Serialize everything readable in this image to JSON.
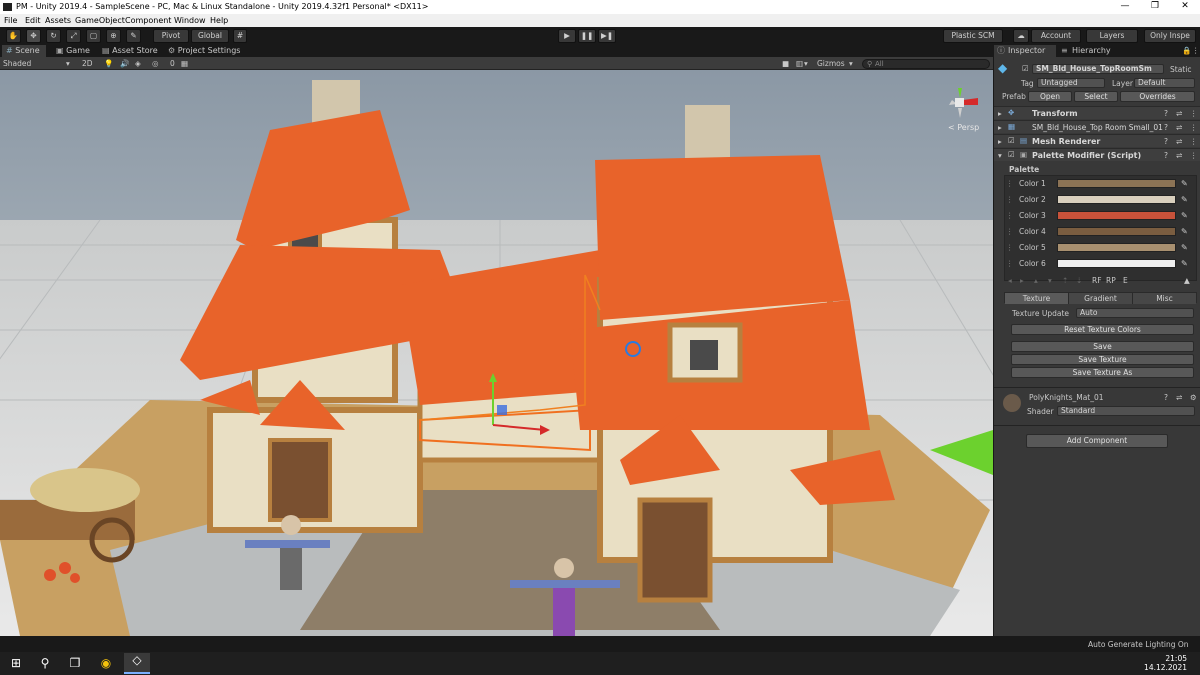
{
  "window": {
    "title": "PM - Unity 2019.4 - SampleScene - PC, Mac & Linux Standalone - Unity 2019.4.32f1 Personal* <DX11>",
    "minimize": "—",
    "maximize": "❐",
    "close": "✕"
  },
  "menu": [
    "File",
    "Edit",
    "Assets",
    "GameObject",
    "Component",
    "Window",
    "Help"
  ],
  "toolbar": {
    "pivot": "Pivot",
    "global": "Global",
    "play": "▶",
    "pause": "❚❚",
    "step": "▶❚",
    "plastic_scm": "Plastic SCM",
    "account": "Account",
    "layers": "Layers",
    "layout": "Only Inspe"
  },
  "scene_tabs": [
    "Scene",
    "Game",
    "Asset Store",
    "Project Settings"
  ],
  "scene_toolbar": {
    "shading_mode": "Shaded",
    "mode_2d": "2D",
    "hidden_count": "0",
    "gizmos": "Gizmos",
    "search_placeholder": "All"
  },
  "gizmo": {
    "axis_label": "< Persp"
  },
  "inspector": {
    "tabs": [
      "Inspector",
      "Hierarchy"
    ],
    "object_name": "SM_Bld_House_TopRoomSm",
    "static_label": "Static",
    "tag_label": "Tag",
    "tag_value": "Untagged",
    "layer_label": "Layer",
    "layer_value": "Default",
    "prefab_label": "Prefab",
    "prefab_open": "Open",
    "prefab_select": "Select",
    "prefab_overrides": "Overrides",
    "components": [
      {
        "name": "Transform"
      },
      {
        "name": "SM_Bld_House_Top Room Small_01"
      },
      {
        "name": "Mesh Renderer"
      },
      {
        "name": "Palette Modifier (Script)"
      }
    ],
    "palette": {
      "header": "Palette",
      "colors": [
        {
          "label": "Color 1",
          "hex": "#8c7355"
        },
        {
          "label": "Color 2",
          "hex": "#d9cfbd"
        },
        {
          "label": "Color 3",
          "hex": "#c8523a"
        },
        {
          "label": "Color 4",
          "hex": "#7a5d40"
        },
        {
          "label": "Color 5",
          "hex": "#a89070"
        },
        {
          "label": "Color 6",
          "hex": "#efefef"
        }
      ],
      "rf": "RF",
      "rp": "RP",
      "e": "E"
    },
    "modes": [
      "Texture",
      "Gradient",
      "Misc"
    ],
    "texture_update_label": "Texture Update",
    "texture_update_value": "Auto",
    "buttons": [
      "Reset Texture Colors",
      "Save",
      "Save Texture",
      "Save Texture As"
    ],
    "material_name": "PolyKnights_Mat_01",
    "shader_label": "Shader",
    "shader_value": "Standard",
    "add_component": "Add Component"
  },
  "statusbar": {
    "text": "Auto Generate Lighting On"
  },
  "taskbar": {
    "time": "21:05",
    "date": "14.12.2021"
  },
  "colors": {
    "roof": "#e8632a",
    "timber": "#b7803f",
    "plaster": "#e9dfc4",
    "ground": "#c8a062",
    "sky": "#a7b4bf"
  }
}
